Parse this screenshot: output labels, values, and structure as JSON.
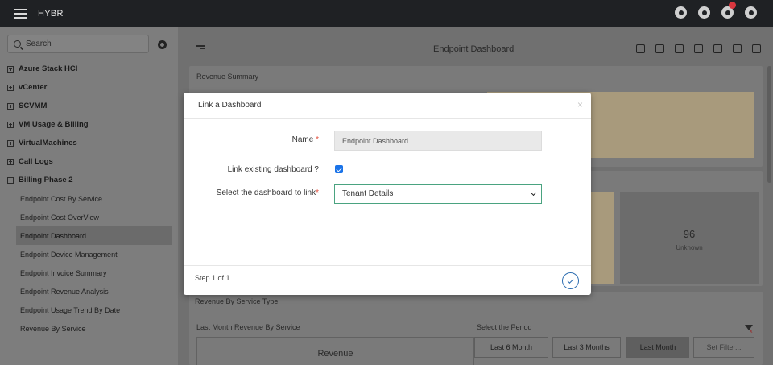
{
  "app": {
    "brand": "HYBR"
  },
  "sidebar": {
    "search_placeholder": "Search",
    "groups": [
      {
        "label": "Azure Stack HCI"
      },
      {
        "label": "vCenter"
      },
      {
        "label": "SCVMM"
      },
      {
        "label": "VM Usage & Billing"
      },
      {
        "label": "VirtualMachines"
      },
      {
        "label": "Call Logs"
      },
      {
        "label": "Billing Phase 2"
      }
    ],
    "items": [
      {
        "label": "Endpoint Cost By Service"
      },
      {
        "label": "Endpoint Cost OverView"
      },
      {
        "label": "Endpoint Dashboard"
      },
      {
        "label": "Endpoint Device Management"
      },
      {
        "label": "Endpoint Invoice Summary"
      },
      {
        "label": "Endpoint Revenue Analysis"
      },
      {
        "label": "Endpoint Usage Trend By Date"
      },
      {
        "label": "Revenue By Service"
      }
    ]
  },
  "main": {
    "title": "Endpoint Dashboard",
    "revenue_summary": "Revenue Summary",
    "unknown_tile": {
      "value": "96",
      "label": "Unknown"
    },
    "revenue_by_service_type": "Revenue By Service Type",
    "last_month_revenue": "Last Month Revenue By Service",
    "select_period": "Select the Period",
    "revenue_label": "Revenue",
    "period_buttons": [
      "Last 6 Month",
      "Last 3 Months",
      "Last Month",
      "Set Filter..."
    ]
  },
  "modal": {
    "title": "Link a Dashboard",
    "close": "×",
    "name_label": "Name",
    "required_mark": "*",
    "name_value": "Endpoint Dashboard",
    "link_existing_label": "Link existing dashboard ?",
    "link_existing_checked": true,
    "select_label": "Select the dashboard to link",
    "select_value": "Tenant Details",
    "step_text": "Step 1 of 1"
  },
  "colors": {
    "topbar": "#1f2124",
    "tile_tan": "#a89a7c",
    "accent_blue": "#1a73e8",
    "required_red": "#e3503f",
    "select_border": "#4aa380"
  }
}
